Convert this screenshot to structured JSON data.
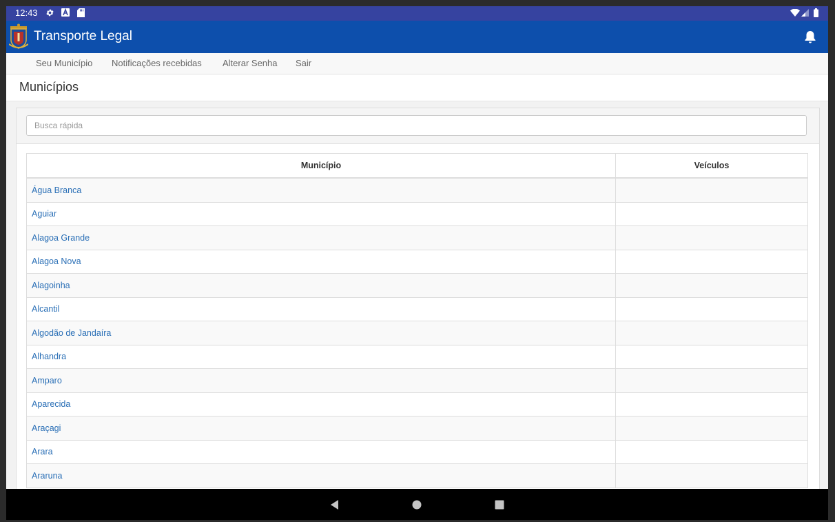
{
  "status_bar": {
    "time": "12:43",
    "icons_left": [
      "settings-icon",
      "a-icon",
      "sd-card-icon"
    ],
    "icons_right": [
      "wifi-icon",
      "signal-icon",
      "battery-icon"
    ]
  },
  "app_bar": {
    "title": "Transporte Legal",
    "logo": "coat-of-arms-logo",
    "notification_icon": "bell-icon"
  },
  "nav": {
    "items": [
      {
        "label": "Seu Município"
      },
      {
        "label": "Notificações recebidas"
      },
      {
        "label": "Alterar Senha"
      },
      {
        "label": "Sair"
      }
    ]
  },
  "page": {
    "title": "Municípios"
  },
  "search": {
    "placeholder": "Busca rápida",
    "value": ""
  },
  "table": {
    "headers": [
      "Município",
      "Veículos"
    ],
    "rows": [
      {
        "municipio": "Água Branca",
        "veiculos": ""
      },
      {
        "municipio": "Aguiar",
        "veiculos": ""
      },
      {
        "municipio": "Alagoa Grande",
        "veiculos": ""
      },
      {
        "municipio": "Alagoa Nova",
        "veiculos": ""
      },
      {
        "municipio": "Alagoinha",
        "veiculos": ""
      },
      {
        "municipio": "Alcantil",
        "veiculos": ""
      },
      {
        "municipio": "Algodão de Jandaíra",
        "veiculos": ""
      },
      {
        "municipio": "Alhandra",
        "veiculos": ""
      },
      {
        "municipio": "Amparo",
        "veiculos": ""
      },
      {
        "municipio": "Aparecida",
        "veiculos": ""
      },
      {
        "municipio": "Araçagi",
        "veiculos": ""
      },
      {
        "municipio": "Arara",
        "veiculos": ""
      },
      {
        "municipio": "Araruna",
        "veiculos": ""
      }
    ]
  },
  "system_nav": {
    "buttons": [
      "back-icon",
      "home-icon",
      "recents-icon"
    ]
  },
  "colors": {
    "status_bar": "#3643a0",
    "app_bar": "#0d4fac",
    "link": "#2a6fb6"
  }
}
